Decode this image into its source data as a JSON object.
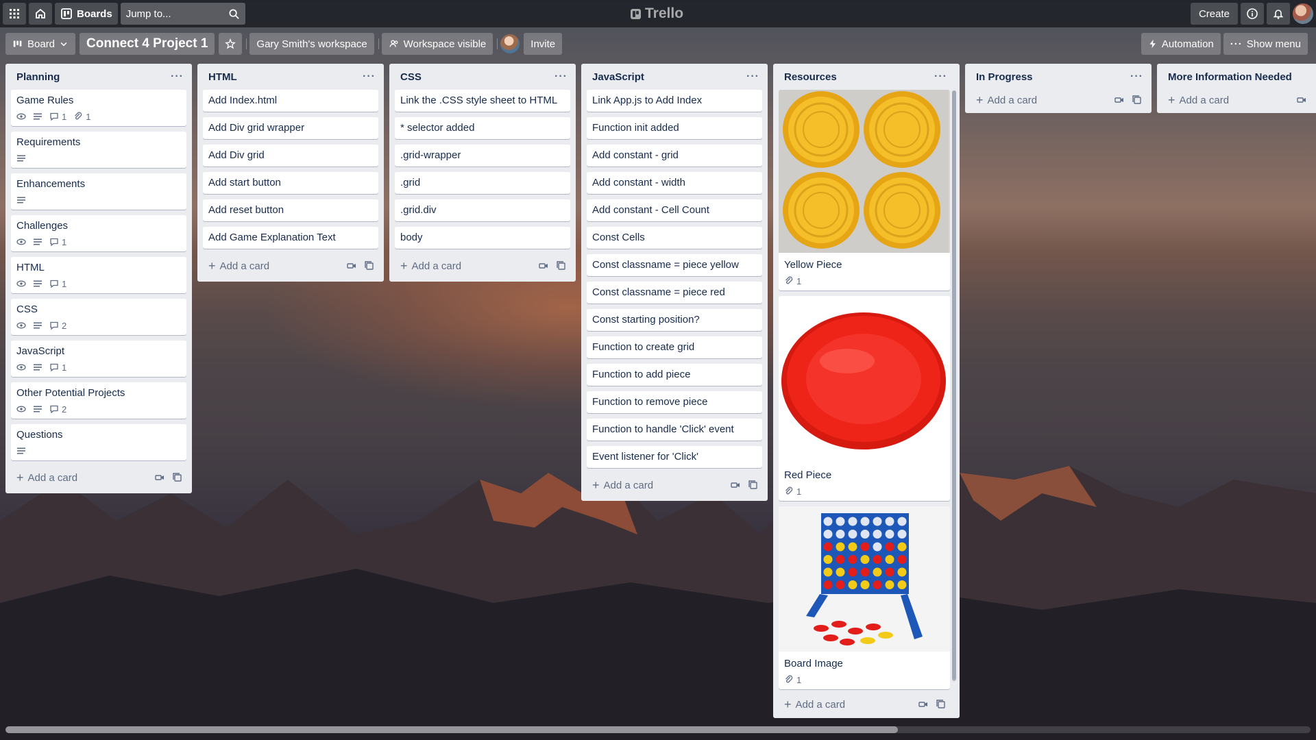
{
  "topbar": {
    "boards_label": "Boards",
    "search_placeholder": "Jump to...",
    "logo_text": "Trello",
    "create_label": "Create"
  },
  "board": {
    "view_label": "Board",
    "title": "Connect 4 Project 1",
    "workspace": "Gary Smith's workspace",
    "visibility": "Workspace visible",
    "invite_label": "Invite",
    "automation_label": "Automation",
    "show_menu_label": "Show menu"
  },
  "lists": {
    "planning": {
      "title": "Planning",
      "cards": [
        {
          "title": "Game Rules",
          "watch": true,
          "desc": true,
          "comments": "1",
          "attachments": "1"
        },
        {
          "title": "Requirements",
          "watch": false,
          "desc": true
        },
        {
          "title": "Enhancements",
          "watch": false,
          "desc": true
        },
        {
          "title": "Challenges",
          "watch": true,
          "desc": true,
          "comments": "1"
        },
        {
          "title": "HTML",
          "watch": true,
          "desc": true,
          "comments": "1"
        },
        {
          "title": "CSS",
          "watch": true,
          "desc": true,
          "comments": "2"
        },
        {
          "title": "JavaScript",
          "watch": true,
          "desc": true,
          "comments": "1"
        },
        {
          "title": "Other Potential Projects",
          "watch": true,
          "desc": true,
          "comments": "2"
        },
        {
          "title": "Questions",
          "watch": false,
          "desc": true
        }
      ]
    },
    "html": {
      "title": "HTML",
      "cards": [
        {
          "title": "Add Index.html"
        },
        {
          "title": "Add Div grid wrapper"
        },
        {
          "title": "Add Div grid"
        },
        {
          "title": "Add start button"
        },
        {
          "title": "Add reset button"
        },
        {
          "title": "Add Game Explanation Text"
        }
      ]
    },
    "css": {
      "title": "CSS",
      "cards": [
        {
          "title": "Link the .CSS style sheet to HTML"
        },
        {
          "title": "* selector added"
        },
        {
          "title": ".grid-wrapper"
        },
        {
          "title": ".grid"
        },
        {
          "title": ".grid.div"
        },
        {
          "title": "body"
        }
      ]
    },
    "javascript": {
      "title": "JavaScript",
      "cards": [
        {
          "title": "Link App.js to Add Index"
        },
        {
          "title": "Function init added"
        },
        {
          "title": "Add constant - grid"
        },
        {
          "title": "Add constant - width"
        },
        {
          "title": "Add constant - Cell Count"
        },
        {
          "title": "Const Cells"
        },
        {
          "title": "Const classname = piece yellow"
        },
        {
          "title": "Const classname = piece red"
        },
        {
          "title": "Const starting position?"
        },
        {
          "title": "Function to create grid"
        },
        {
          "title": "Function to add piece"
        },
        {
          "title": "Function to remove piece"
        },
        {
          "title": "Function to handle 'Click' event"
        },
        {
          "title": "Event listener for 'Click'"
        }
      ]
    },
    "resources": {
      "title": "Resources",
      "cards": [
        {
          "title": "Yellow Piece",
          "attachments": "1",
          "image": "yellow-pieces",
          "color": "#f2b91e"
        },
        {
          "title": "Red Piece",
          "attachments": "1",
          "image": "red-piece",
          "color": "#ee2015"
        },
        {
          "title": "Board Image",
          "attachments": "1",
          "image": "connect-four-board",
          "color": "#1d57b8"
        }
      ]
    },
    "in_progress": {
      "title": "In Progress"
    },
    "more_info": {
      "title": "More Information Needed"
    }
  },
  "common": {
    "add_card_label": "Add a card"
  }
}
